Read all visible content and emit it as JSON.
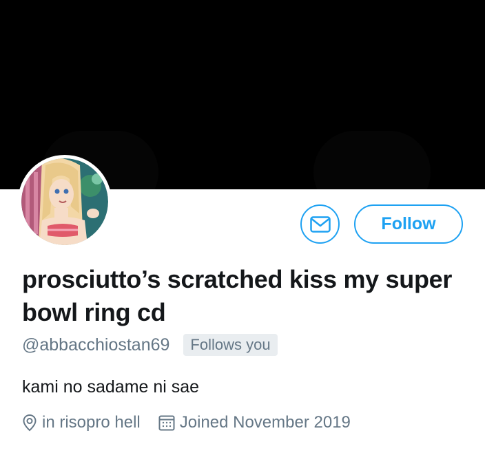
{
  "profile": {
    "display_name": "prosciutto’s scratched kiss my super bowl ring cd",
    "handle": "@abbacchiostan69",
    "follows_you_badge": "Follows you",
    "bio": "kami no sadame ni sae",
    "location": "in risopro hell",
    "joined": "Joined November 2019"
  },
  "actions": {
    "follow_label": "Follow",
    "dm_icon": "envelope-icon"
  },
  "icons": {
    "location": "location-pin-icon",
    "calendar": "calendar-icon"
  },
  "colors": {
    "accent": "#1da1f2",
    "secondary_text": "#657786",
    "primary_text": "#14171a",
    "banner": "#000000",
    "badge_bg": "#e9edf0"
  }
}
